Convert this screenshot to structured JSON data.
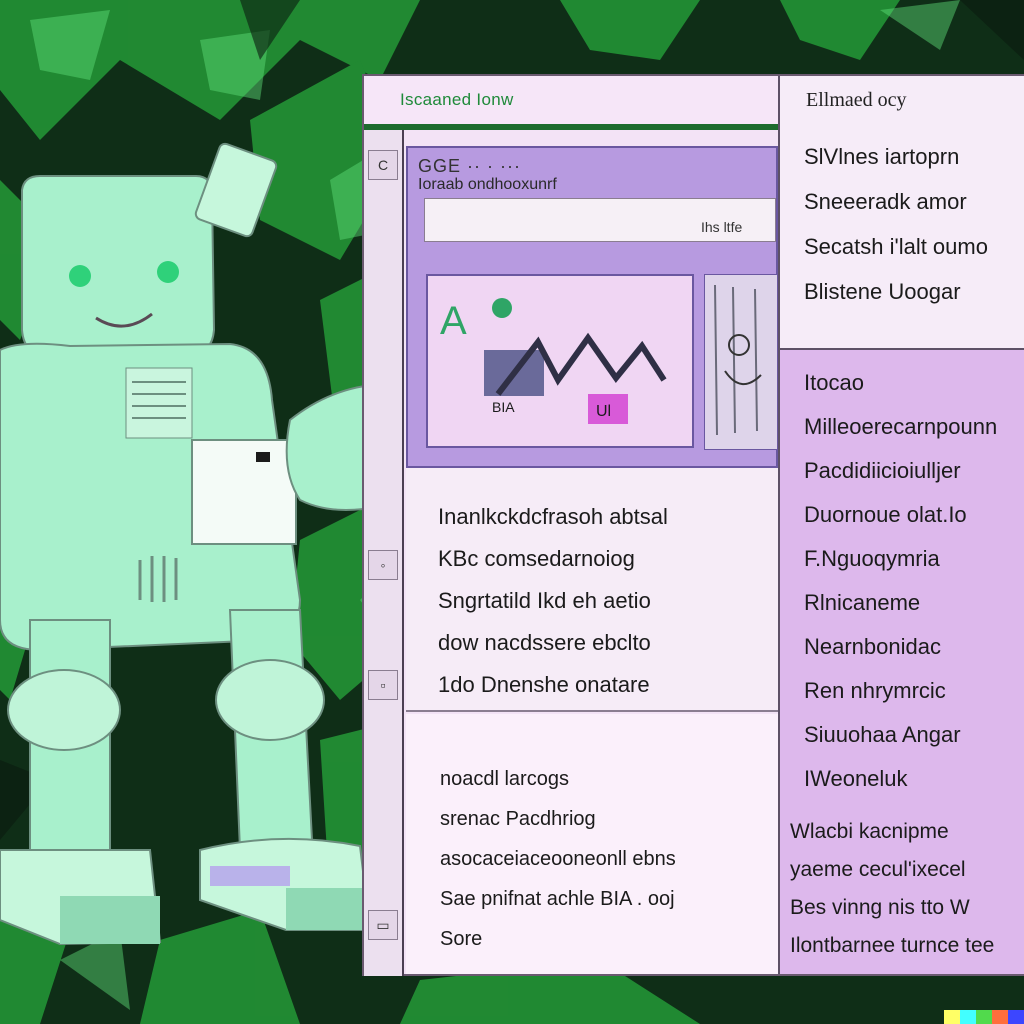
{
  "window": {
    "title": "Iscaaned Ionw",
    "right_title": "Ellmaed ocy"
  },
  "right_panel": {
    "items": [
      "SlVlnes iartoprn",
      "Sneeeradk amor",
      "Secatsh i'lalt oumo",
      "Blistene Uoogar"
    ],
    "section_title": "Itocao",
    "section_items": [
      "Milleoerecarnpounn",
      "Pacdidiicioiulljer",
      "Duornoue olat.Io",
      "F.Nguoqymria",
      "Rlnicaneme",
      "Nearnbonidac",
      "Ren nhrymrcic",
      "Siuuohaa Angar",
      "IWeoneluk"
    ],
    "footer_lines": [
      "Wlacbi kacnipme",
      "yaeme cecul'ixecel",
      "Bes vinng nis tto W",
      "Ilontbarnee turnce tee"
    ]
  },
  "preview": {
    "header": "GGE ·· · ···",
    "subtitle": "Ioraab ondhooxunrf",
    "bar_label": "Ihs ltfe",
    "chart_label": "BIA",
    "badge": "Ul"
  },
  "middle_block": {
    "lines": [
      "Inanlkckdcfrasoh abtsal",
      "KBc comsedarnoiog",
      "Sngrtatild Ikd eh aetio",
      "dow nacdssere ebclto",
      "1do Dnenshe onatare"
    ]
  },
  "lower_block": {
    "lines": [
      "noacdl larcogs",
      "srenac Pacdhriog",
      "asocaceiaceooneonll ebns",
      "Sae pnifnat achle BIA . ooj",
      "Sore"
    ]
  },
  "colors": {
    "robot_body": "#a8f0cc",
    "panel_purple": "#ddb8ec",
    "panel_pink": "#f3e3f6",
    "accent_green": "#1f8a3a",
    "background_green": "#1c7a30"
  }
}
